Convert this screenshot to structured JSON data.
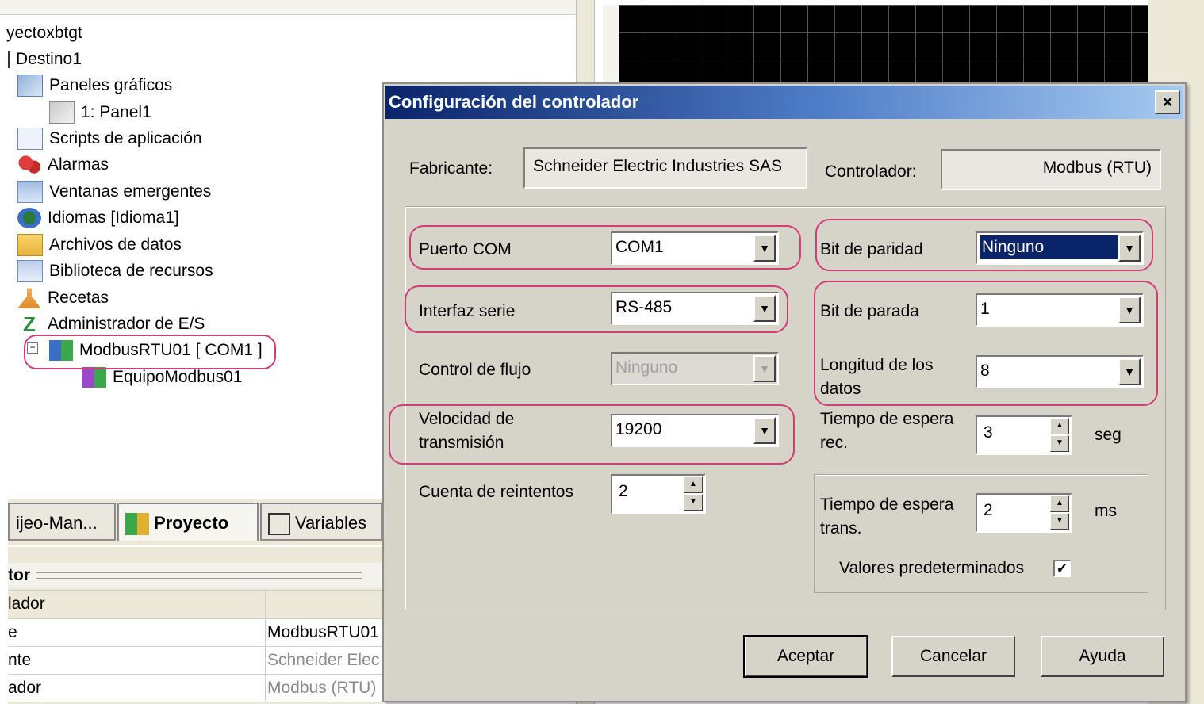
{
  "tree": {
    "items": [
      {
        "label": "yectoxbtgt",
        "icon": "project-icon"
      },
      {
        "label": "Destino1",
        "icon": "target-icon"
      },
      {
        "label": "Paneles gráficos",
        "icon": "panels-icon"
      },
      {
        "label": "1: Panel1",
        "icon": "panel-icon"
      },
      {
        "label": "Scripts de aplicación",
        "icon": "scripts-icon"
      },
      {
        "label": "Alarmas",
        "icon": "alarms-icon"
      },
      {
        "label": "Ventanas emergentes",
        "icon": "popup-windows-icon"
      },
      {
        "label": "Idiomas [Idioma1]",
        "icon": "languages-icon"
      },
      {
        "label": "Archivos de datos",
        "icon": "data-files-icon"
      },
      {
        "label": "Biblioteca de recursos",
        "icon": "resource-library-icon"
      },
      {
        "label": "Recetas",
        "icon": "recipes-icon"
      },
      {
        "label": "Administrador de E/S",
        "icon": "io-manager-icon"
      },
      {
        "label": "ModbusRTU01 [ COM1 ]",
        "icon": "driver-icon"
      },
      {
        "label": "EquipoModbus01",
        "icon": "device-icon"
      }
    ]
  },
  "tabs": [
    {
      "label": "ijeo-Man..."
    },
    {
      "label": "Proyecto"
    },
    {
      "label": "Variables"
    }
  ],
  "properties": {
    "title": "tor",
    "header": "lador",
    "rows": [
      {
        "name": "e",
        "value": "ModbusRTU01"
      },
      {
        "name": "nte",
        "value": "Schneider Elec"
      },
      {
        "name": "ador",
        "value": "Modbus (RTU)"
      }
    ]
  },
  "dialog": {
    "title": "Configuración del controlador",
    "close_label": "×",
    "fabricante_label": "Fabricante:",
    "fabricante_value": "Schneider Electric Industries SAS",
    "controlador_label": "Controlador:",
    "controlador_value": "Modbus (RTU)",
    "puerto_com_label": "Puerto COM",
    "puerto_com_value": "COM1",
    "interfaz_serie_label": "Interfaz serie",
    "interfaz_serie_value": "RS-485",
    "control_flujo_label": "Control de flujo",
    "control_flujo_value": "Ninguno",
    "velocidad_label_1": "Velocidad de",
    "velocidad_label_2": "transmisión",
    "velocidad_value": "19200",
    "reintentos_label": "Cuenta de reintentos",
    "reintentos_value": "2",
    "paridad_label": "Bit de paridad",
    "paridad_value": "Ninguno",
    "parada_label": "Bit de parada",
    "parada_value": "1",
    "longitud_label_1": "Longitud de los",
    "longitud_label_2": "datos",
    "longitud_value": "8",
    "espera_rec_label_1": "Tiempo de espera",
    "espera_rec_label_2": "rec.",
    "espera_rec_value": "3",
    "espera_rec_unit": "seg",
    "espera_trans_label_1": "Tiempo de espera",
    "espera_trans_label_2": "trans.",
    "espera_trans_value": "2",
    "espera_trans_unit": "ms",
    "valores_label": "Valores predeterminados",
    "valores_checked": "✓",
    "aceptar_label": "Aceptar",
    "cancelar_label": "Cancelar",
    "ayuda_label": "Ayuda"
  },
  "colors": {
    "highlight": "#d23c78",
    "titlebar_start": "#0a246a",
    "selection": "#0a246a"
  }
}
